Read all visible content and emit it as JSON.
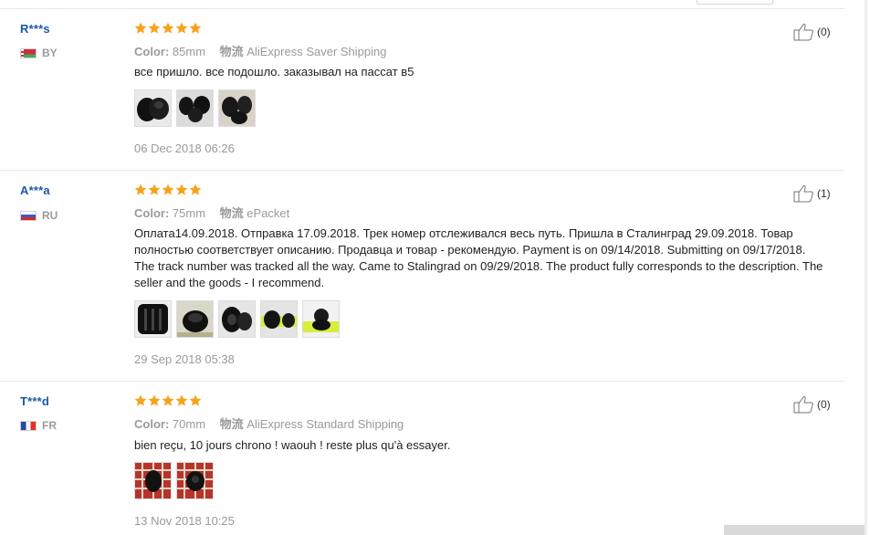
{
  "reviews": [
    {
      "user": "R***s",
      "country": "BY",
      "rating": 5,
      "color_label": "Color:",
      "color_value": "85mm",
      "shipping_label": "物流",
      "shipping_value": "AliExpress Saver Shipping",
      "feedback": "все пришло. все подошло. заказывал на пассат в5",
      "photos": [
        "rubber-cap-photo",
        "rubber-cap-photo",
        "rubber-cap-photo"
      ],
      "date": "06 Dec 2018 06:26",
      "helpful_count": "(0)"
    },
    {
      "user": "A***a",
      "country": "RU",
      "rating": 5,
      "color_label": "Color:",
      "color_value": "75mm",
      "shipping_label": "物流",
      "shipping_value": "ePacket",
      "feedback": "Оплата14.09.2018. Отправка 17.09.2018. Трек номер отслеживался весь путь. Пришла в Сталинград 29.09.2018. Товар полностью соответствует описанию. Продавца и товар - рекомендую. Payment is on 09/14/2018. Submitting on 09/17/2018. The track number was tracked all the way. Came to Stalingrad on 09/29/2018. The product fully corresponds to the description. The seller and the goods - I recommend.",
      "photos": [
        "rubber-cap-photo",
        "rubber-cap-photo",
        "rubber-cap-photo",
        "rubber-cap-photo",
        "rubber-cap-photo"
      ],
      "date": "29 Sep 2018 05:38",
      "helpful_count": "(1)"
    },
    {
      "user": "T***d",
      "country": "FR",
      "rating": 5,
      "color_label": "Color:",
      "color_value": "70mm",
      "shipping_label": "物流",
      "shipping_value": "AliExpress Standard Shipping",
      "feedback": "bien reçu, 10 jours chrono ! waouh ! reste plus qu'à essayer.",
      "photos": [
        "rubber-cap-photo",
        "rubber-cap-photo"
      ],
      "date": "13 Nov 2018 10:25",
      "helpful_count": "(0)"
    }
  ],
  "colors": {
    "user_name": "#1a5aa8",
    "star": "#f7a21a",
    "muted": "#9a9a9a",
    "text": "#222222"
  }
}
